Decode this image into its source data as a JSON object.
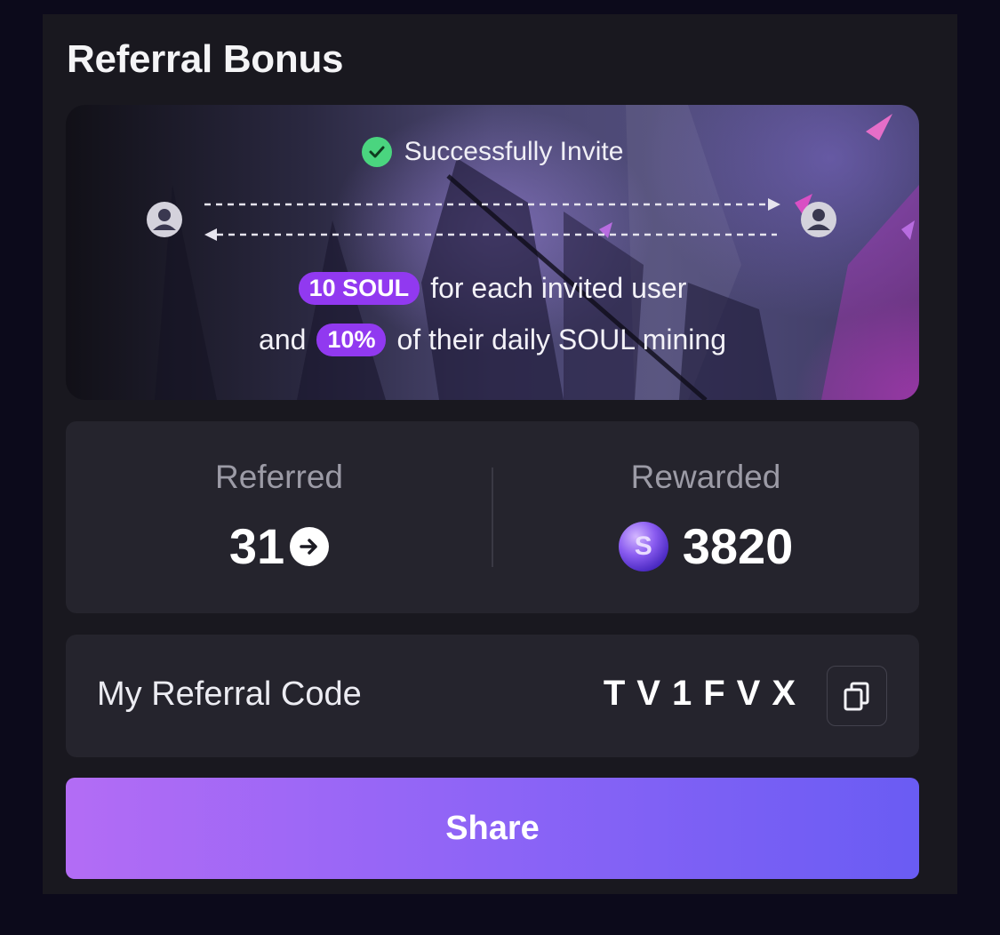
{
  "title": "Referral Bonus",
  "banner": {
    "invite_text": "Successfully Invite",
    "line1_pill": "10 SOUL",
    "line1_text": "for each invited user",
    "line2_prefix": "and",
    "line2_pill": "10%",
    "line2_text": "of their daily SOUL mining"
  },
  "stats": {
    "referred_label": "Referred",
    "referred_value": "31",
    "rewarded_label": "Rewarded",
    "rewarded_value": "3820",
    "coin_symbol": "S"
  },
  "referral_code": {
    "label": "My Referral Code",
    "value": "TV1FVX"
  },
  "share_label": "Share",
  "colors": {
    "accent_pill": "#9139f0",
    "check_green": "#4ad57f",
    "share_gradient_start": "#b36cf5",
    "share_gradient_end": "#6a5cf3"
  },
  "icons": [
    "check-circle-icon",
    "user-avatar-icon",
    "arrow-right-circle-icon",
    "soul-coin-icon",
    "copy-icon"
  ]
}
